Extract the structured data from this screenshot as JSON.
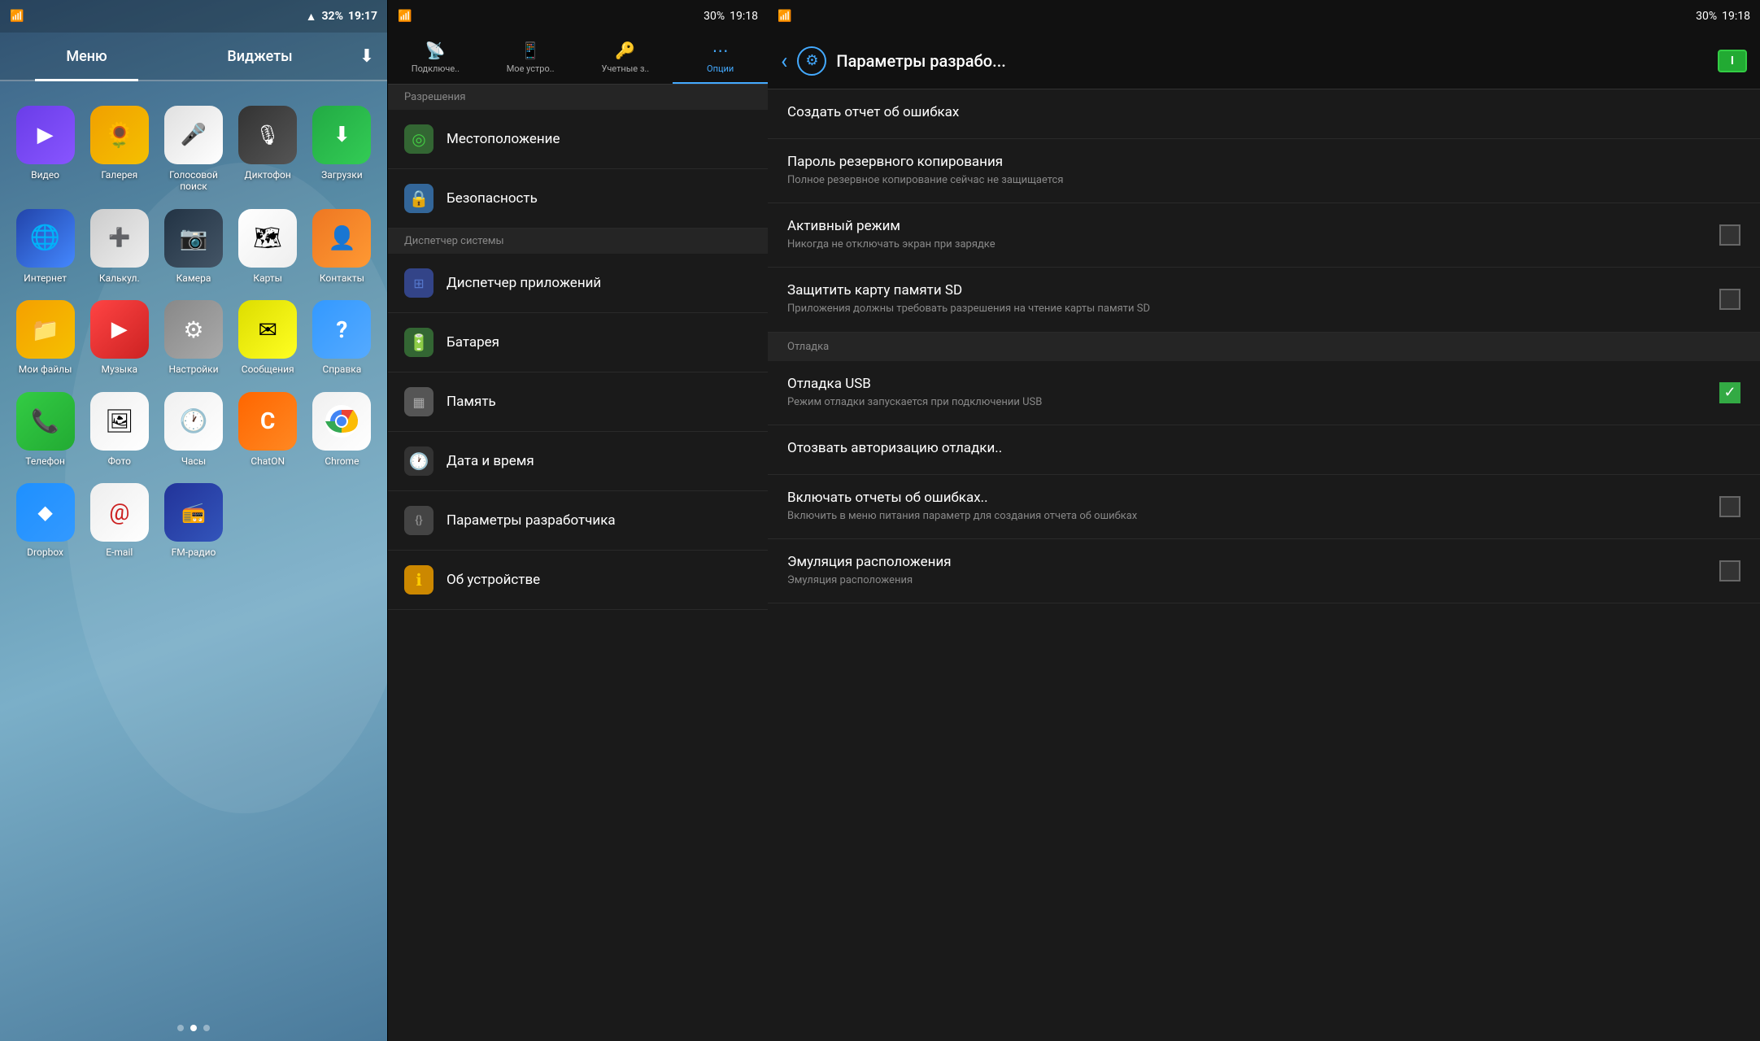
{
  "home": {
    "status": {
      "time": "19:17",
      "battery": "32%",
      "signal": "▂▄▆",
      "wifi": "WiFi"
    },
    "tabs": [
      {
        "id": "menu",
        "label": "Меню",
        "active": true
      },
      {
        "id": "widgets",
        "label": "Виджеты",
        "active": false
      }
    ],
    "apps": [
      {
        "id": "video",
        "label": "Видео",
        "icon": "▶",
        "iconClass": "icon-video"
      },
      {
        "id": "gallery",
        "label": "Галерея",
        "icon": "🌼",
        "iconClass": "icon-gallery"
      },
      {
        "id": "voice",
        "label": "Голосовой поиск",
        "icon": "🎤",
        "iconClass": "icon-voice"
      },
      {
        "id": "dictaphone",
        "label": "Диктофон",
        "icon": "🎙",
        "iconClass": "icon-dictaphone"
      },
      {
        "id": "downloads",
        "label": "Загрузки",
        "icon": "⬇",
        "iconClass": "icon-downloads"
      },
      {
        "id": "internet",
        "label": "Интернет",
        "icon": "🌐",
        "iconClass": "icon-internet"
      },
      {
        "id": "calc",
        "label": "Калькул.",
        "icon": "🔢",
        "iconClass": "icon-calc"
      },
      {
        "id": "camera",
        "label": "Камера",
        "icon": "📷",
        "iconClass": "icon-camera"
      },
      {
        "id": "maps",
        "label": "Карты",
        "icon": "🗺",
        "iconClass": "icon-maps"
      },
      {
        "id": "contacts",
        "label": "Контакты",
        "icon": "👤",
        "iconClass": "icon-contacts"
      },
      {
        "id": "myfiles",
        "label": "Мои файлы",
        "icon": "📁",
        "iconClass": "icon-myfiles"
      },
      {
        "id": "music",
        "label": "Музыка",
        "icon": "▶",
        "iconClass": "icon-music"
      },
      {
        "id": "settings",
        "label": "Настройки",
        "icon": "⚙",
        "iconClass": "icon-settings"
      },
      {
        "id": "messages",
        "label": "Сообщения",
        "icon": "✉",
        "iconClass": "icon-messages"
      },
      {
        "id": "help",
        "label": "Справка",
        "icon": "?",
        "iconClass": "icon-help"
      },
      {
        "id": "phone",
        "label": "Телефон",
        "icon": "📞",
        "iconClass": "icon-phone"
      },
      {
        "id": "photos",
        "label": "Фото",
        "icon": "🖼",
        "iconClass": "icon-photos"
      },
      {
        "id": "clock",
        "label": "Часы",
        "icon": "🕐",
        "iconClass": "icon-clock"
      },
      {
        "id": "chaton",
        "label": "ChatON",
        "icon": "C",
        "iconClass": "icon-chaton"
      },
      {
        "id": "chrome",
        "label": "Chrome",
        "icon": "◎",
        "iconClass": "icon-chrome"
      },
      {
        "id": "dropbox",
        "label": "Dropbox",
        "icon": "◆",
        "iconClass": "icon-dropbox"
      },
      {
        "id": "email",
        "label": "E-mail",
        "icon": "@",
        "iconClass": "icon-email"
      },
      {
        "id": "fmradio",
        "label": "FM-радио",
        "icon": "📻",
        "iconClass": "icon-fmradio"
      }
    ],
    "dots": [
      false,
      true,
      false
    ]
  },
  "settings": {
    "status": {
      "time": "19:18",
      "battery": "30%"
    },
    "tabs": [
      {
        "id": "connect",
        "label": "Подключе..",
        "icon": "📡",
        "active": false
      },
      {
        "id": "device",
        "label": "Мое устро..",
        "icon": "📱",
        "active": false
      },
      {
        "id": "accounts",
        "label": "Учетные з..",
        "icon": "🔑",
        "active": false
      },
      {
        "id": "options",
        "label": "Опции",
        "icon": "⋯",
        "active": true
      }
    ],
    "sections": [
      {
        "header": "Разрешения",
        "items": [
          {
            "id": "location",
            "label": "Местоположение",
            "icon": "◎",
            "iconClass": "si-location"
          },
          {
            "id": "security",
            "label": "Безопасность",
            "icon": "🔒",
            "iconClass": "si-security"
          }
        ]
      },
      {
        "header": "Диспетчер системы",
        "items": [
          {
            "id": "appmanager",
            "label": "Диспетчер приложений",
            "icon": "⊞",
            "iconClass": "si-appmanager"
          },
          {
            "id": "battery",
            "label": "Батарея",
            "icon": "🔋",
            "iconClass": "si-battery"
          },
          {
            "id": "memory",
            "label": "Память",
            "icon": "💾",
            "iconClass": "si-memory"
          },
          {
            "id": "datetime",
            "label": "Дата и время",
            "icon": "🕐",
            "iconClass": "si-datetime"
          },
          {
            "id": "developer",
            "label": "Параметры разработчика",
            "icon": "{}",
            "iconClass": "si-developer"
          },
          {
            "id": "about",
            "label": "Об устройстве",
            "icon": "ℹ",
            "iconClass": "si-about"
          }
        ]
      }
    ]
  },
  "developer": {
    "status": {
      "time": "19:18",
      "battery": "30%"
    },
    "header": {
      "back_icon": "‹",
      "settings_icon": "⚙",
      "title": "Параметры разрабо...",
      "battery_label": "I"
    },
    "items": [
      {
        "id": "bug-report",
        "title": "Создать отчет об ошибках",
        "subtitle": "",
        "has_checkbox": false,
        "checked": false,
        "is_section": false
      },
      {
        "id": "backup-password",
        "title": "Пароль резервного копирования",
        "subtitle": "Полное резервное копирование сейчас не защищается",
        "has_checkbox": false,
        "checked": false,
        "is_section": false
      },
      {
        "id": "active-mode",
        "title": "Активный режим",
        "subtitle": "Никогда не отключать экран при зарядке",
        "has_checkbox": true,
        "checked": false,
        "is_section": false
      },
      {
        "id": "protect-sd",
        "title": "Защитить карту памяти SD",
        "subtitle": "Приложения должны требовать разрешения на чтение карты памяти SD",
        "has_checkbox": true,
        "checked": false,
        "is_section": false
      },
      {
        "id": "debug-section",
        "title": "Отладка",
        "subtitle": "",
        "has_checkbox": false,
        "checked": false,
        "is_section": true
      },
      {
        "id": "usb-debug",
        "title": "Отладка USB",
        "subtitle": "Режим отладки запускается при подключении USB",
        "has_checkbox": true,
        "checked": true,
        "is_section": false
      },
      {
        "id": "revoke-auth",
        "title": "Отозвать авторизацию отладки..",
        "subtitle": "",
        "has_checkbox": false,
        "checked": false,
        "is_section": false
      },
      {
        "id": "error-reports",
        "title": "Включать отчеты об ошибках..",
        "subtitle": "Включить в меню питания параметр для создания отчета об ошибках",
        "has_checkbox": true,
        "checked": false,
        "is_section": false
      },
      {
        "id": "mock-location",
        "title": "Эмуляция расположения",
        "subtitle": "Эмуляция расположения",
        "has_checkbox": true,
        "checked": false,
        "is_section": false
      }
    ]
  }
}
